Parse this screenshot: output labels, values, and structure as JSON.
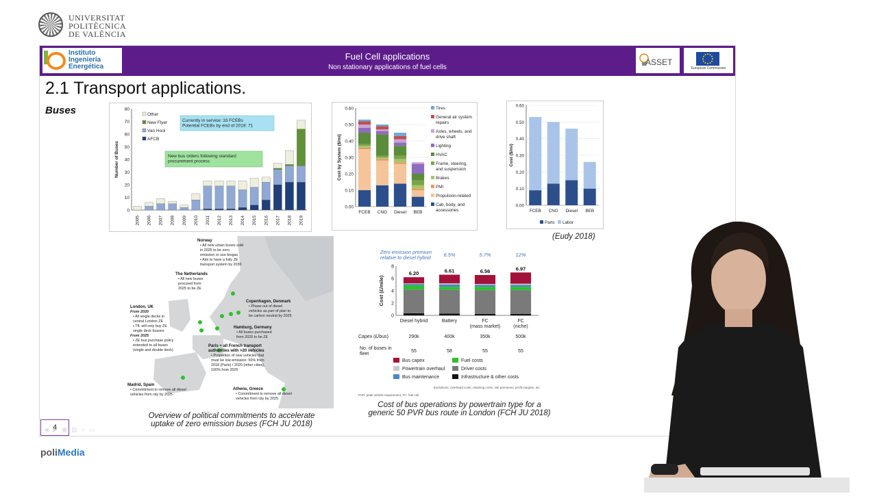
{
  "university": {
    "name_lines": "UNIVERSITAT\nPOLITÈCNICA\nDE VALÈNCIA"
  },
  "header": {
    "institute": "Instituto\nIngeniería\nEnergética",
    "title": "Fuel Cell applications",
    "subtitle": "Non stationary applications of fuel cells",
    "asset_logo": "ASSET",
    "eu_label": "European Commission"
  },
  "slide": {
    "title": "2.1 Transport applications.",
    "section": "Buses",
    "page_number": "4",
    "eudy_citation": "(Eudy 2018)",
    "caption_map": "Overview of political commitments to accelerate\nuptake of zero emission buses (FCH JU 2018)",
    "caption_cost": "Cost of bus operations by powertrain type for a\ngeneric 50 PVR bus route in London (FCH JU 2018)"
  },
  "branding": {
    "poli": "poli",
    "media": "Media"
  },
  "colors": {
    "banner": "#5c1d8a",
    "accent": "#2b78c4"
  },
  "chart_data": [
    {
      "type": "bar",
      "stacked": true,
      "ylabel": "Number of Buses",
      "ylim": [
        0,
        80
      ],
      "yticks": [
        0,
        10,
        20,
        30,
        40,
        50,
        60,
        70,
        80
      ],
      "categories": [
        "2005",
        "2006",
        "2007",
        "2008",
        "2009",
        "2010",
        "2011",
        "2012",
        "2013",
        "2014",
        "2015",
        "2016",
        "2017",
        "2018",
        "2019"
      ],
      "series": [
        {
          "name": "AFCB",
          "color": "#1f3f7a",
          "values": [
            0,
            0,
            0,
            0,
            0,
            0,
            1,
            1,
            1,
            2,
            4,
            8,
            20,
            22,
            22
          ]
        },
        {
          "name": "Van Hool",
          "color": "#8fa8d4",
          "values": [
            0,
            3,
            5,
            5,
            2,
            8,
            18,
            18,
            18,
            14,
            14,
            14,
            12,
            13,
            13
          ]
        },
        {
          "name": "New Flyer",
          "color": "#5f9137",
          "values": [
            0,
            0,
            0,
            0,
            0,
            0,
            0,
            0,
            0,
            0,
            0,
            0,
            1,
            1,
            29
          ]
        },
        {
          "name": "Other",
          "color": "#eeeedd",
          "values": [
            3,
            3,
            4,
            2,
            2,
            5,
            4,
            4,
            4,
            7,
            7,
            4,
            4,
            11,
            7
          ]
        }
      ],
      "annotations": [
        "Currently in service: 33 FCEBs\nPotential FCEBs by end of 2019: 71",
        "New bus orders following standard\nprocurement process"
      ]
    },
    {
      "type": "bar",
      "stacked": true,
      "ylabel": "Cost by System ($/mi)",
      "ylim": [
        0,
        0.6
      ],
      "yticks": [
        "0.00",
        "0.10",
        "0.20",
        "0.30",
        "0.40",
        "0.50",
        "0.60"
      ],
      "categories": [
        "FCEB",
        "CNG",
        "Diesel",
        "BEB"
      ],
      "series": [
        {
          "name": "Cab, body, and accessories",
          "color": "#2c4f8c",
          "values": [
            0.1,
            0.13,
            0.14,
            0.06
          ]
        },
        {
          "name": "Propulsion-related",
          "color": "#f5c49a",
          "values": [
            0.25,
            0.15,
            0.12,
            0.04
          ]
        },
        {
          "name": "PMI",
          "color": "#e59a5c",
          "values": [
            0.01,
            0.01,
            0.01,
            0.01
          ]
        },
        {
          "name": "Brakes",
          "color": "#a6c66e",
          "values": [
            0.01,
            0.01,
            0.02,
            0.02
          ]
        },
        {
          "name": "Frame, steering, and suspension",
          "color": "#7da34a",
          "values": [
            0.01,
            0.01,
            0.02,
            0.03
          ]
        },
        {
          "name": "HVAC",
          "color": "#5b8c3a",
          "values": [
            0.07,
            0.13,
            0.06,
            0.04
          ]
        },
        {
          "name": "Lighting",
          "color": "#8e6dbf",
          "values": [
            0.03,
            0.02,
            0.02,
            0.06
          ]
        },
        {
          "name": "Axles, wheels, and drive shaft",
          "color": "#c9a3d6",
          "values": [
            0.02,
            0.01,
            0.02,
            0.01
          ]
        },
        {
          "name": "General air system repairs",
          "color": "#c0504d",
          "values": [
            0.02,
            0.02,
            0.02,
            0.0
          ]
        },
        {
          "name": "Tires",
          "color": "#6fa8d6",
          "values": [
            0.01,
            0.01,
            0.02,
            0.0
          ]
        }
      ]
    },
    {
      "type": "bar",
      "stacked": true,
      "ylabel": "Cost ($/mi)",
      "ylim": [
        0,
        0.6
      ],
      "yticks": [
        "0.00",
        "0.10",
        "0.20",
        "0.30",
        "0.40",
        "0.50",
        "0.60"
      ],
      "categories": [
        "FCEB",
        "CNG",
        "Diesel",
        "BEB"
      ],
      "series": [
        {
          "name": "Parts",
          "color": "#2c4f8c",
          "values": [
            0.09,
            0.13,
            0.15,
            0.1
          ]
        },
        {
          "name": "Labor",
          "color": "#a9c4e8",
          "values": [
            0.44,
            0.37,
            0.31,
            0.16
          ]
        }
      ]
    },
    {
      "type": "bar",
      "stacked": true,
      "ylabel": "Cost (£/mile)",
      "ylim": [
        0,
        8
      ],
      "yticks": [
        0,
        2,
        4,
        6,
        8
      ],
      "categories": [
        "Diesel hybrid",
        "Battery",
        "FC\n(mass market)",
        "FC\n(niche)"
      ],
      "totals": [
        "6.20",
        "6.61",
        "6.56",
        "6.97"
      ],
      "premium_header": "Zero emission premium\nrelative to diesel hybrid",
      "premiums": [
        "6.5%",
        "5.7%",
        "12%"
      ],
      "series": [
        {
          "name": "Infrastructure & other costs",
          "color": "#111111",
          "values": [
            0.35,
            0.3,
            0.25,
            0.25
          ]
        },
        {
          "name": "Driver costs",
          "color": "#7a7a7a",
          "values": [
            3.85,
            3.85,
            3.85,
            3.85
          ]
        },
        {
          "name": "Fuel costs",
          "color": "#2ec02e",
          "values": [
            0.7,
            0.5,
            0.55,
            0.55
          ]
        },
        {
          "name": "Bus maintenance",
          "color": "#4a86c8",
          "values": [
            0.2,
            0.35,
            0.3,
            0.3
          ]
        },
        {
          "name": "Powertrain overhaul",
          "color": "#c8c8c8",
          "values": [
            0.1,
            0.2,
            0.15,
            0.2
          ]
        },
        {
          "name": "Bus capex",
          "color": "#a3123a",
          "values": [
            1.0,
            1.41,
            1.46,
            1.82
          ]
        }
      ],
      "table": {
        "capex_label": "Capex (£/bus)",
        "capex": [
          "290k",
          "400k",
          "350k",
          "500k"
        ],
        "fleet_label": "No. of buses in\nfleet",
        "fleet": [
          "55",
          "58",
          "55",
          "55"
        ]
      },
      "footnotes": [
        "Exclusions: overhead costs, retaining costs, risk premiums, profit margins, etc.",
        "PVR: peak vehicle requirement, FC: fuel cell"
      ]
    }
  ],
  "map": {
    "notes": [
      {
        "id": "norway",
        "title": "Norway",
        "lines": [
          "• All new urban buses sold",
          "  in 2025 to be zero",
          "  emission or use biogas",
          "• Aim to have a fully ZE",
          "  transport system by 2030"
        ]
      },
      {
        "id": "netherlands",
        "title": "The Netherlands",
        "lines": [
          "• All new buses",
          "  procured from",
          "  2025 to be ZE"
        ]
      },
      {
        "id": "london",
        "title": "London, UK",
        "lines": [
          "From 2020",
          "• All single decks in",
          "  central London ZE",
          "• TfL will only buy ZE",
          "  single deck busses",
          "From 2025",
          "• ZE bus purchase policy",
          "  extended to all buses",
          "  (single and double deck)"
        ]
      },
      {
        "id": "copenhagen",
        "title": "Copenhagen, Denmark",
        "lines": [
          "• Phase out of diesel",
          "  vehicles as part of plan to",
          "  be carbon neutral by 2025"
        ]
      },
      {
        "id": "hamburg",
        "title": "Hamburg, Germany",
        "lines": [
          "• All buses purchased",
          "  from 2020 to be ZE"
        ]
      },
      {
        "id": "paris",
        "title": "Paris + all French transport\nauthorities with >20 vehicles",
        "lines": [
          "• Proportion of new vehicles that",
          "  must be low emission: 50% from",
          "  2018 (Paris) / 2020 (other cities),",
          "  100% from 2025"
        ]
      },
      {
        "id": "madrid",
        "title": "Madrid, Spain",
        "lines": [
          "• Commitment to remove all diesel",
          "  vehicles from city by 2025"
        ]
      },
      {
        "id": "athens",
        "title": "Athens, Greece",
        "lines": [
          "• Commitment to remove all diesel",
          "  vehicles from city by 2025"
        ]
      }
    ]
  }
}
